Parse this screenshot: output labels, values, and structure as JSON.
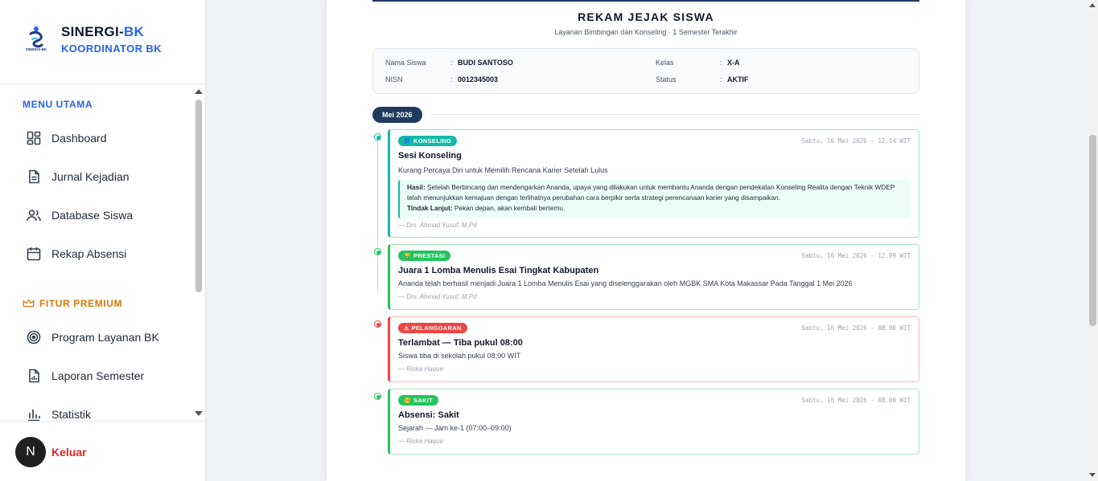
{
  "brand": {
    "title_main": "SINERGI-",
    "title_accent": "BK",
    "subtitle": "KOORDINATOR BK",
    "logo_text": "SINERGI-BK"
  },
  "menu": {
    "section_main": "MENU UTAMA",
    "items_main": [
      {
        "label": "Dashboard",
        "icon": "dashboard-icon"
      },
      {
        "label": "Jurnal Kejadian",
        "icon": "document-icon"
      },
      {
        "label": "Database Siswa",
        "icon": "users-icon"
      },
      {
        "label": "Rekap Absensi",
        "icon": "calendar-icon"
      }
    ],
    "section_premium": "FITUR PREMIUM",
    "items_premium": [
      {
        "label": "Program Layanan BK",
        "icon": "target-icon"
      },
      {
        "label": "Laporan Semester",
        "icon": "report-icon"
      },
      {
        "label": "Statistik",
        "icon": "bar-chart-icon"
      }
    ]
  },
  "logout": {
    "avatar_letter": "N",
    "label": "Keluar"
  },
  "report": {
    "title": "REKAM JEJAK SISWA",
    "subtitle": "Layanan Bimbingan dan Konseling · 1 Semester Terakhir",
    "student": {
      "name_label": "Nama Siswa",
      "name": "BUDI SANTOSO",
      "nisn_label": "NISN",
      "nisn": "0012345003",
      "class_label": "Kelas",
      "class": "X-A",
      "status_label": "Status",
      "status": "AKTIF",
      "colon": ":"
    },
    "month": "Mei 2026",
    "entries": [
      {
        "badge": "KONSELING",
        "badge_icon": "📘",
        "time": "Sabtu, 16 Mei 2026 - 12.14 WIT",
        "title": "Sesi Konseling",
        "desc": "Kurang Percaya Diri untuk Memilih Rencana Karier Setelah Lulus",
        "hasil_label": "Hasil:",
        "hasil_text": "Setelah Berbincang dan mendengarkan Ananda, upaya yang dilakukan untuk membantu Ananda dengan pendekatan Konseling Realita dengan Teknik WDEP telah menunjukkan kemajuan dengan terlihatnya perubahan cara berpikir serta strategi perencanaan karier yang disampaikan.",
        "tindak_label": "Tindak Lanjut:",
        "tindak_text": "Pekan depan, akan kembali bertemu.",
        "author": "— Drs. Ahmad Yusuf, M.Pd",
        "color": "#14b8a6"
      },
      {
        "badge": "PRESTASI",
        "badge_icon": "🏆",
        "time": "Sabtu, 16 Mei 2026 - 12.09 WIT",
        "title": "Juara 1 Lomba Menulis Esai Tingkat Kabupaten",
        "desc": "Ananda telah berhasil menjadi Juara 1 Lomba Menulis Esai yang diselenggarakan oleh MGBK SMA Kota Makassar Pada Tanggal 1 Mei 2026",
        "author": "— Drs. Ahmad Yusuf, M.Pd",
        "color": "#22c55e"
      },
      {
        "badge": "PELANGGARAN",
        "badge_icon": "⚠",
        "time": "Sabtu, 16 Mei 2026 - 08.00 WIT",
        "title": "Terlambat — Tiba pukul 08:00",
        "desc": "Siswa tiba di sekolah pukul 08:00 WIT",
        "author": "— Riska Haque",
        "color": "#ef4444"
      },
      {
        "badge": "SAKIT",
        "badge_icon": "🤒",
        "time": "Sabtu, 16 Mei 2026 - 08.00 WIT",
        "title": "Absensi: Sakit",
        "desc": "Sejarah — Jam ke-1 (07:00–09:00)",
        "author": "— Riska Haque",
        "color": "#22c55e"
      }
    ]
  }
}
